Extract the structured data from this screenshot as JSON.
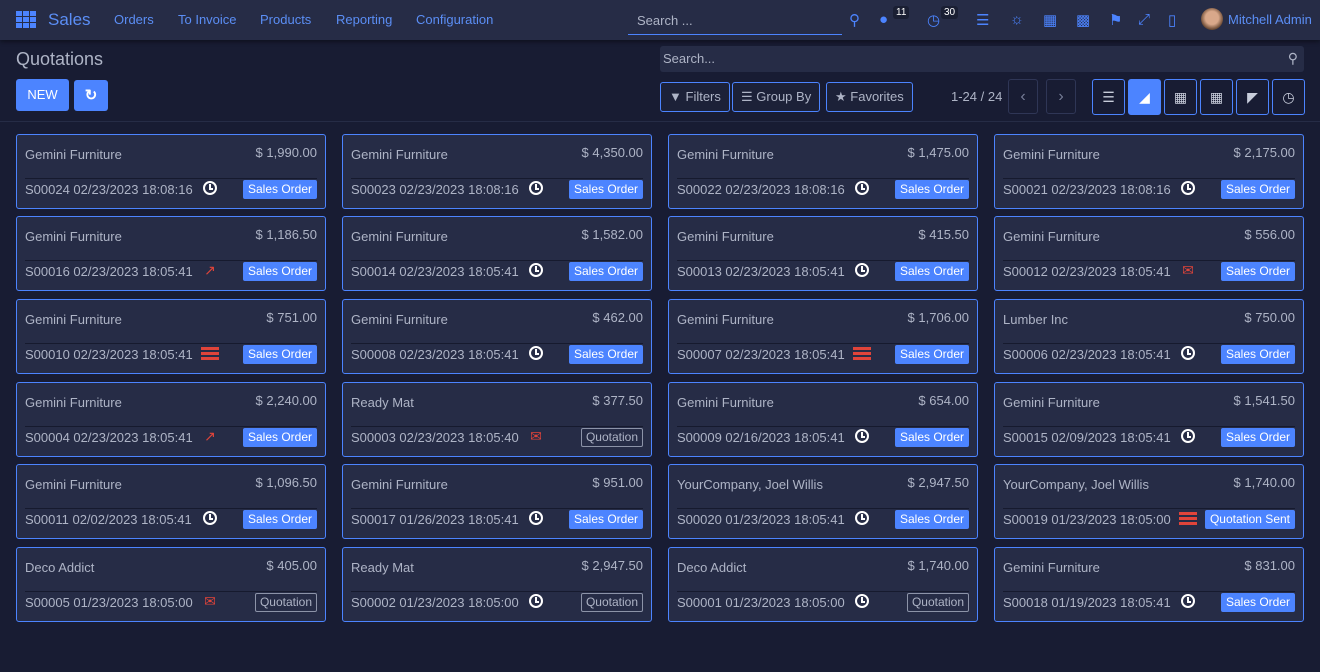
{
  "nav": {
    "app": "Sales",
    "menu": [
      "Orders",
      "To Invoice",
      "Products",
      "Reporting",
      "Configuration"
    ],
    "search_placeholder": "Search ...",
    "messages_count": "11",
    "activities_count": "30",
    "user": "Mitchell Admin"
  },
  "page": {
    "title": "Quotations",
    "new_label": "NEW",
    "search_placeholder": "Search...",
    "filters": "Filters",
    "group_by": "Group By",
    "favorites": "Favorites",
    "pager": "1-24 / 24",
    "active_view": "kanban"
  },
  "colors": {
    "accent": "#4c84ff",
    "background": "#181c33",
    "card": "#262c46",
    "activity_warning": "#e0443a"
  },
  "cards": [
    {
      "customer": "Gemini Furniture",
      "amount": "$ 1,990.00",
      "ref": "S00024 02/23/2023 18:08:16",
      "activity": "clock",
      "status": "Sales Order"
    },
    {
      "customer": "Gemini Furniture",
      "amount": "$ 4,350.00",
      "ref": "S00023 02/23/2023 18:08:16",
      "activity": "clock",
      "status": "Sales Order"
    },
    {
      "customer": "Gemini Furniture",
      "amount": "$ 1,475.00",
      "ref": "S00022 02/23/2023 18:08:16",
      "activity": "clock",
      "status": "Sales Order"
    },
    {
      "customer": "Gemini Furniture",
      "amount": "$ 2,175.00",
      "ref": "S00021 02/23/2023 18:08:16",
      "activity": "clock",
      "status": "Sales Order"
    },
    {
      "customer": "Gemini Furniture",
      "amount": "$ 1,186.50",
      "ref": "S00016 02/23/2023 18:05:41",
      "activity": "trend",
      "status": "Sales Order"
    },
    {
      "customer": "Gemini Furniture",
      "amount": "$ 1,582.00",
      "ref": "S00014 02/23/2023 18:05:41",
      "activity": "clock",
      "status": "Sales Order"
    },
    {
      "customer": "Gemini Furniture",
      "amount": "$ 415.50",
      "ref": "S00013 02/23/2023 18:05:41",
      "activity": "clock",
      "status": "Sales Order"
    },
    {
      "customer": "Gemini Furniture",
      "amount": "$ 556.00",
      "ref": "S00012 02/23/2023 18:05:41",
      "activity": "email",
      "status": "Sales Order"
    },
    {
      "customer": "Gemini Furniture",
      "amount": "$ 751.00",
      "ref": "S00010 02/23/2023 18:05:41",
      "activity": "server",
      "status": "Sales Order"
    },
    {
      "customer": "Gemini Furniture",
      "amount": "$ 462.00",
      "ref": "S00008 02/23/2023 18:05:41",
      "activity": "clock",
      "status": "Sales Order"
    },
    {
      "customer": "Gemini Furniture",
      "amount": "$ 1,706.00",
      "ref": "S00007 02/23/2023 18:05:41",
      "activity": "server",
      "status": "Sales Order"
    },
    {
      "customer": "Lumber Inc",
      "amount": "$ 750.00",
      "ref": "S00006 02/23/2023 18:05:41",
      "activity": "clock",
      "status": "Sales Order"
    },
    {
      "customer": "Gemini Furniture",
      "amount": "$ 2,240.00",
      "ref": "S00004 02/23/2023 18:05:41",
      "activity": "trend",
      "status": "Sales Order"
    },
    {
      "customer": "Ready Mat",
      "amount": "$ 377.50",
      "ref": "S00003 02/23/2023 18:05:40",
      "activity": "email",
      "status": "Quotation"
    },
    {
      "customer": "Gemini Furniture",
      "amount": "$ 654.00",
      "ref": "S00009 02/16/2023 18:05:41",
      "activity": "clock",
      "status": "Sales Order"
    },
    {
      "customer": "Gemini Furniture",
      "amount": "$ 1,541.50",
      "ref": "S00015 02/09/2023 18:05:41",
      "activity": "clock",
      "status": "Sales Order"
    },
    {
      "customer": "Gemini Furniture",
      "amount": "$ 1,096.50",
      "ref": "S00011 02/02/2023 18:05:41",
      "activity": "clock",
      "status": "Sales Order"
    },
    {
      "customer": "Gemini Furniture",
      "amount": "$ 951.00",
      "ref": "S00017 01/26/2023 18:05:41",
      "activity": "clock",
      "status": "Sales Order"
    },
    {
      "customer": "YourCompany, Joel Willis",
      "amount": "$ 2,947.50",
      "ref": "S00020 01/23/2023 18:05:41",
      "activity": "clock",
      "status": "Sales Order"
    },
    {
      "customer": "YourCompany, Joel Willis",
      "amount": "$ 1,740.00",
      "ref": "S00019 01/23/2023 18:05:00",
      "activity": "server",
      "status": "Quotation Sent"
    },
    {
      "customer": "Deco Addict",
      "amount": "$ 405.00",
      "ref": "S00005 01/23/2023 18:05:00",
      "activity": "email",
      "status": "Quotation"
    },
    {
      "customer": "Ready Mat",
      "amount": "$ 2,947.50",
      "ref": "S00002 01/23/2023 18:05:00",
      "activity": "clock",
      "status": "Quotation"
    },
    {
      "customer": "Deco Addict",
      "amount": "$ 1,740.00",
      "ref": "S00001 01/23/2023 18:05:00",
      "activity": "clock",
      "status": "Quotation"
    },
    {
      "customer": "Gemini Furniture",
      "amount": "$ 831.00",
      "ref": "S00018 01/19/2023 18:05:41",
      "activity": "clock",
      "status": "Sales Order"
    }
  ]
}
